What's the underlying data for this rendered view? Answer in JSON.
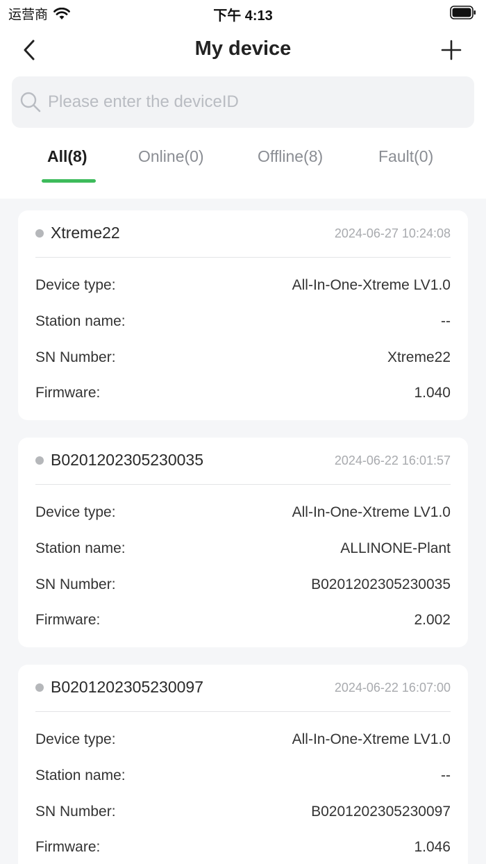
{
  "status_bar": {
    "carrier": "运营商",
    "time": "下午 4:13"
  },
  "header": {
    "title": "My device",
    "back_icon": "chevron-left-icon",
    "add_icon": "plus-icon"
  },
  "search": {
    "placeholder": "Please enter the deviceID",
    "value": ""
  },
  "tabs": [
    {
      "label": "All(8)",
      "active": true
    },
    {
      "label": "Online(0)",
      "active": false
    },
    {
      "label": "Offline(8)",
      "active": false
    },
    {
      "label": "Fault(0)",
      "active": false
    }
  ],
  "accent_color": "#3dbb5b",
  "field_labels": {
    "device_type": "Device type:",
    "station_name": "Station name:",
    "sn_number": "SN Number:",
    "firmware": "Firmware:"
  },
  "devices": [
    {
      "name": "Xtreme22",
      "timestamp": "2024-06-27 10:24:08",
      "status": "offline",
      "device_type": "All-In-One-Xtreme LV1.0",
      "station_name": "--",
      "sn_number": "Xtreme22",
      "firmware": "1.040"
    },
    {
      "name": "B0201202305230035",
      "timestamp": "2024-06-22 16:01:57",
      "status": "offline",
      "device_type": "All-In-One-Xtreme LV1.0",
      "station_name": "ALLINONE-Plant",
      "sn_number": "B0201202305230035",
      "firmware": "2.002"
    },
    {
      "name": "B0201202305230097",
      "timestamp": "2024-06-22 16:07:00",
      "status": "offline",
      "device_type": "All-In-One-Xtreme LV1.0",
      "station_name": "--",
      "sn_number": "B0201202305230097",
      "firmware": "1.046"
    }
  ]
}
